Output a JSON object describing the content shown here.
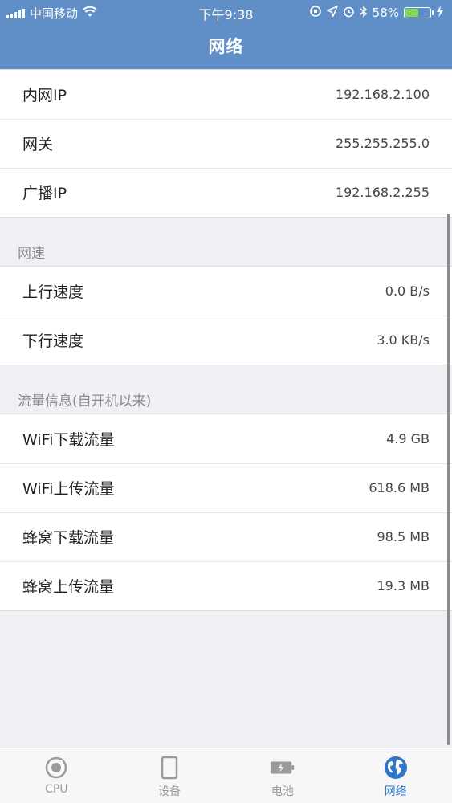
{
  "status_bar": {
    "carrier": "中国移动",
    "time": "下午9:38",
    "battery_percent": "58%",
    "battery_level": 0.58
  },
  "nav": {
    "title": "网络"
  },
  "groups": [
    {
      "header": "",
      "rows": [
        {
          "label": "内网IP",
          "value": "192.168.2.100"
        },
        {
          "label": "网关",
          "value": "255.255.255.0"
        },
        {
          "label": "广播IP",
          "value": "192.168.2.255"
        }
      ]
    },
    {
      "header": "网速",
      "rows": [
        {
          "label": "上行速度",
          "value": "0.0 B/s"
        },
        {
          "label": "下行速度",
          "value": "3.0 KB/s"
        }
      ]
    },
    {
      "header": "流量信息(自开机以来)",
      "rows": [
        {
          "label": "WiFi下载流量",
          "value": "4.9 GB"
        },
        {
          "label": "WiFi上传流量",
          "value": "618.6 MB"
        },
        {
          "label": "蜂窝下载流量",
          "value": "98.5 MB"
        },
        {
          "label": "蜂窝上传流量",
          "value": "19.3 MB"
        }
      ]
    }
  ],
  "tabs": [
    {
      "label": "CPU",
      "icon": "cpu-icon",
      "active": false
    },
    {
      "label": "设备",
      "icon": "device-icon",
      "active": false
    },
    {
      "label": "电池",
      "icon": "battery-icon",
      "active": false
    },
    {
      "label": "网络",
      "icon": "globe-icon",
      "active": true
    }
  ],
  "colors": {
    "header": "#5f8fc6",
    "accent": "#2f76c9",
    "background": "#efeff4"
  }
}
